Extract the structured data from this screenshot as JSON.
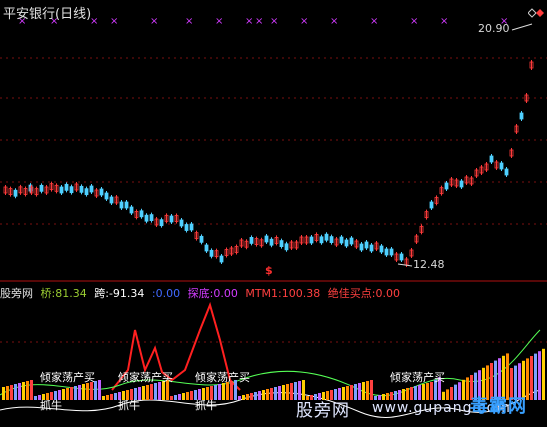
{
  "title": "平安银行(日线)",
  "price_labels": {
    "high": "20.90",
    "low": "12.48",
    "signal": "$"
  },
  "indicator": {
    "name": "股旁网",
    "qiao_label": "桥:",
    "qiao_value": "81.34",
    "kua_label": "跨:",
    "kua_value": "-91.34",
    "c_value": ":0.00",
    "tandi_label": "探底:",
    "tandi_value": "0.00",
    "mtm_label": "MTM1:",
    "mtm_value": "100.38",
    "best_buy_label": "绝佳买点:",
    "best_buy_value": "0.00"
  },
  "annotations": {
    "sell": "倾家荡产买",
    "catch": "抓牛"
  },
  "watermark": {
    "cn": "股旁网",
    "url": "www.gupang.com",
    "brand": "毒霸网"
  },
  "colors": {
    "bg": "#000000",
    "up": "#ff3b3b",
    "down": "#4fd0ff",
    "cross": "#d23cff"
  }
}
